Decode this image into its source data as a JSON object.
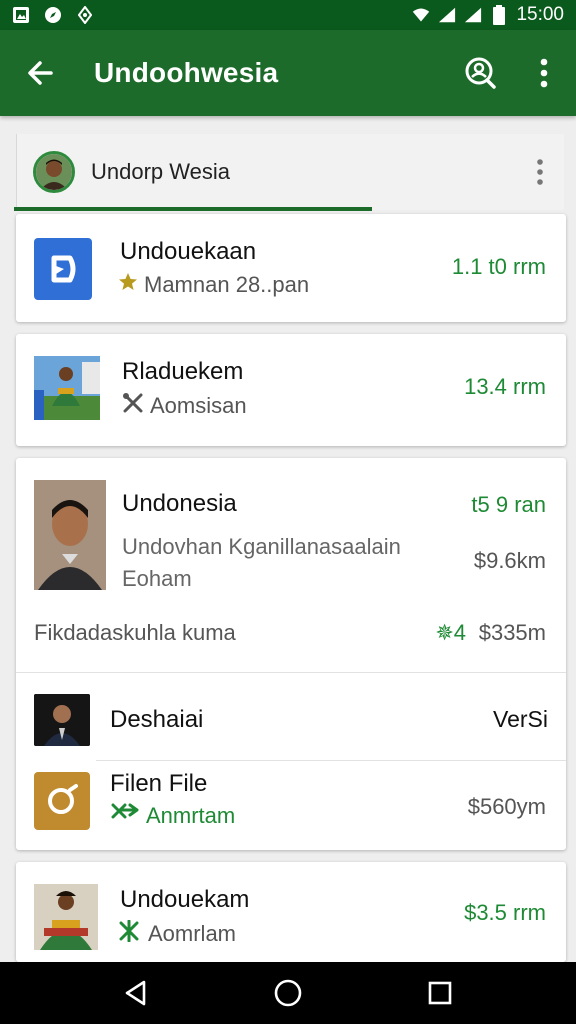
{
  "status_bar": {
    "time": "15:00",
    "icons": [
      "gallery-icon",
      "compass-icon",
      "location-icon",
      "wifi-icon",
      "signal-icon",
      "signal-icon",
      "battery-icon"
    ]
  },
  "app_bar": {
    "title": "Undoohwesia",
    "icons": [
      "back-arrow-icon",
      "search-person-icon",
      "more-vert-icon"
    ],
    "bg_color": "#1d6b2b"
  },
  "profile_header": {
    "name": "Undorp Wesia",
    "icon": "more-vert-icon"
  },
  "items": [
    {
      "title": "Undouekaan",
      "subtitle": "Mamnan 28..pan",
      "subtitle_icon": "star-icon",
      "value": "1.1 t0 rrm"
    },
    {
      "title": "Rladuekem",
      "subtitle": "Aomsisan",
      "subtitle_icon": "tools-icon",
      "value": "13.4 rrm"
    },
    {
      "title": "Undonesia",
      "value": "t5 9 ran",
      "desc_line1": "Undovhan Kganillanasaalain",
      "desc_line2": "Eoham",
      "desc_value": "$9.6km",
      "footer": "Fikdadaskuhla kuma",
      "footer_badge": "✵4",
      "footer_value": "$335m"
    },
    {
      "title": "Deshaiai",
      "value": "VerSi"
    },
    {
      "title": "Filen File",
      "subtitle": "Anmrtam",
      "subtitle_icon": "cross-arrows-icon",
      "value": "$560ym"
    },
    {
      "title": "Undouekam",
      "subtitle": "Aomrlam",
      "subtitle_icon": "cross-arrows-icon",
      "value": "$3.5 rrm"
    }
  ],
  "nav_bar": {
    "icons": [
      "back-triangle-icon",
      "home-circle-icon",
      "recents-square-icon"
    ]
  },
  "colors": {
    "accent_green": "#1f8a35",
    "status_bar": "#0b5a1d"
  }
}
